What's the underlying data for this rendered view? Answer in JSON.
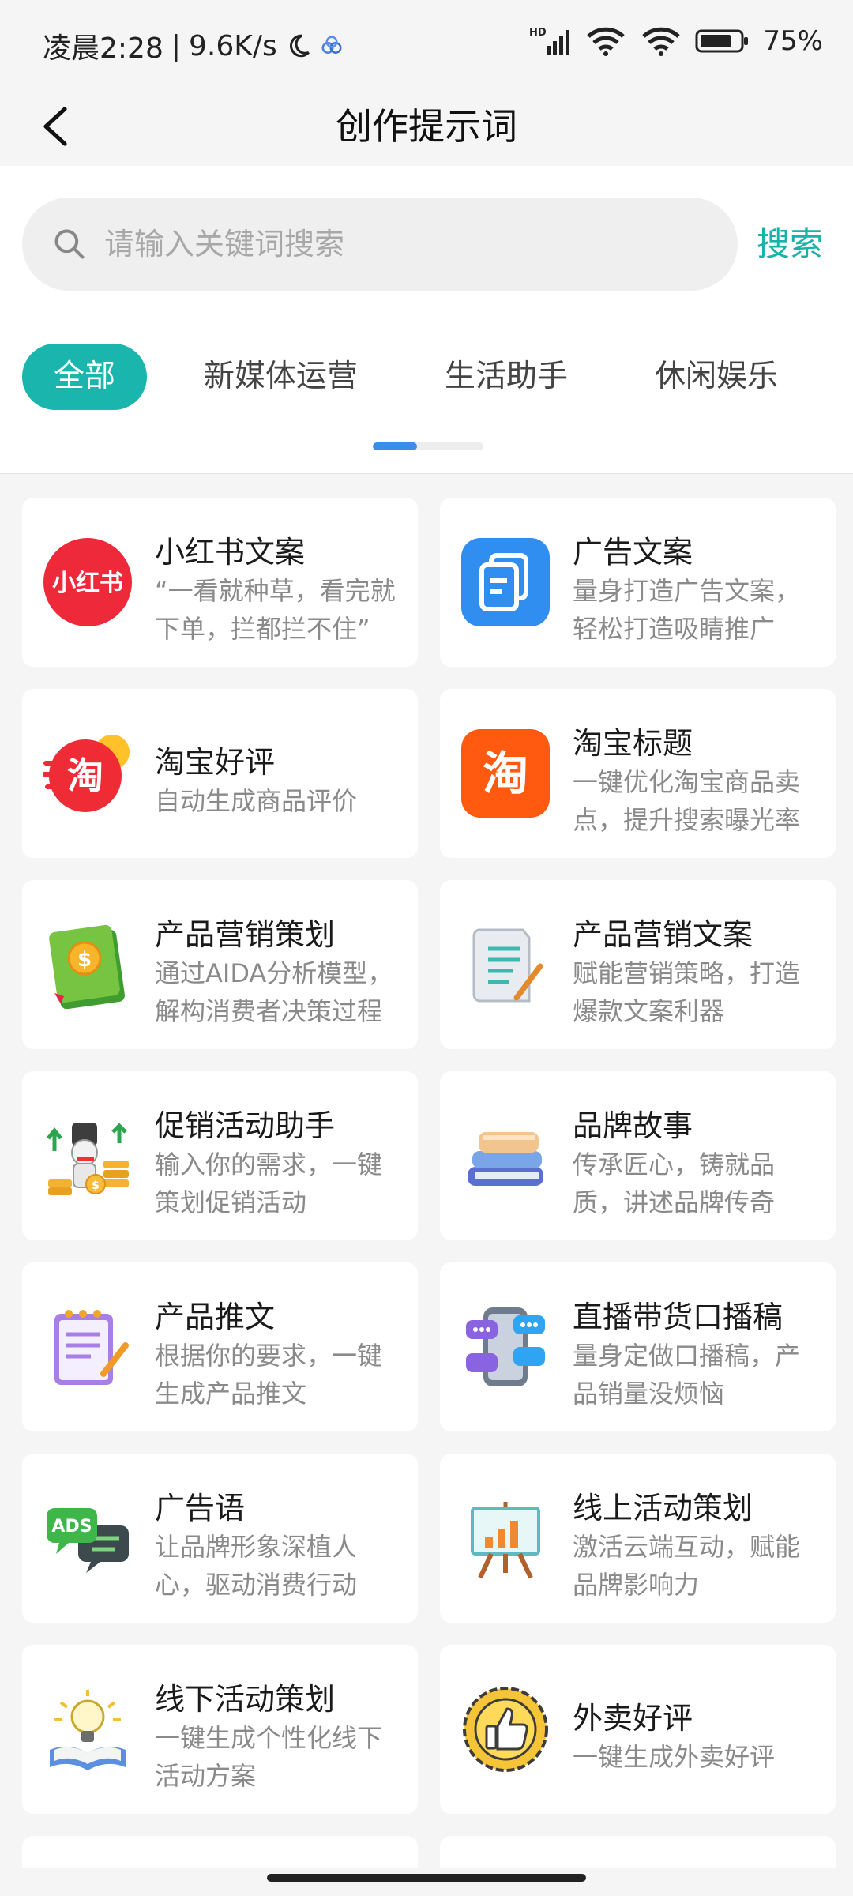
{
  "status_bar": {
    "time": "凌晨2:28",
    "net_speed": "9.6K/s",
    "battery": "75%",
    "signal_label": "HD",
    "icons": [
      "moon-icon",
      "app-icon",
      "signal-icon",
      "wifi-icon",
      "wifi-icon",
      "battery-icon"
    ]
  },
  "nav": {
    "title": "创作提示词",
    "back_icon": "back-arrow-icon"
  },
  "search": {
    "placeholder": "请输入关键词搜索",
    "value": "",
    "button_label": "搜索",
    "accent": "#17b2a8"
  },
  "tabs": [
    {
      "label": "全部",
      "active": true
    },
    {
      "label": "新媒体运营",
      "active": false
    },
    {
      "label": "生活助手",
      "active": false
    },
    {
      "label": "休闲娱乐",
      "active": false
    }
  ],
  "tab_scroll_progress": 0.4,
  "cards": [
    {
      "title": "小红书文案",
      "desc": "“一看就种草，看完就下单，拦都拦不住”",
      "icon": "xiaohongshu-icon"
    },
    {
      "title": "广告文案",
      "desc": "量身打造广告文案，轻松打造吸睛推广",
      "icon": "document-icon"
    },
    {
      "title": "淘宝好评",
      "desc": "自动生成商品评价",
      "icon": "taobao-icon"
    },
    {
      "title": "淘宝标题",
      "desc": "一键优化淘宝商品卖点，提升搜索曝光率",
      "icon": "taobao-icon"
    },
    {
      "title": "产品营销策划",
      "desc": "通过AIDA分析模型，解构消费者决策过程",
      "icon": "money-book-icon"
    },
    {
      "title": "产品营销文案",
      "desc": "赋能营销策略，打造爆款文案利器",
      "icon": "scroll-pen-icon"
    },
    {
      "title": "促销活动助手",
      "desc": "输入你的需求，一键策划促销活动",
      "icon": "promotion-icon"
    },
    {
      "title": "品牌故事",
      "desc": "传承匠心，铸就品质，讲述品牌传奇",
      "icon": "books-icon"
    },
    {
      "title": "产品推文",
      "desc": "根据你的要求，一键生成产品推文",
      "icon": "notepad-icon"
    },
    {
      "title": "直播带货口播稿",
      "desc": "量身定做口播稿，产品销量没烦恼",
      "icon": "phone-chat-icon"
    },
    {
      "title": "广告语",
      "desc": "让品牌形象深植人心，驱动消费行动",
      "icon": "ads-icon"
    },
    {
      "title": "线上活动策划",
      "desc": "激活云端互动，赋能品牌影响力",
      "icon": "easel-chart-icon"
    },
    {
      "title": "线下活动策划",
      "desc": "一键生成个性化线下活动方案",
      "icon": "lightbulb-book-icon"
    },
    {
      "title": "外卖好评",
      "desc": "一键生成外卖好评",
      "icon": "thumbs-up-badge-icon"
    }
  ],
  "colors": {
    "accent": "#1ab5ad",
    "background": "#f5f5f5",
    "card": "#ffffff"
  }
}
